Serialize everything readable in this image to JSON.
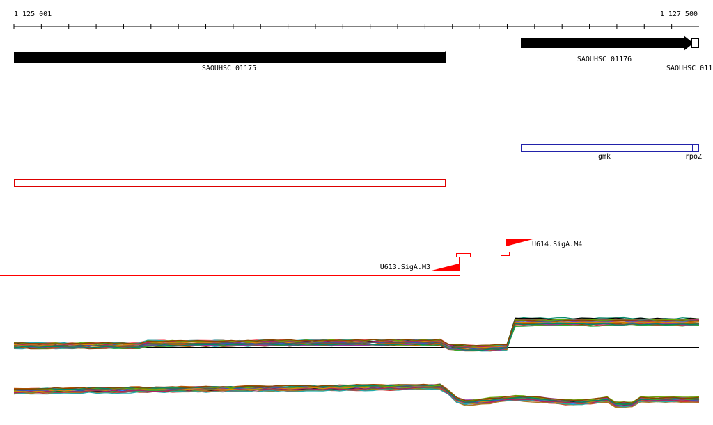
{
  "ruler": {
    "start_label": "1 125 001",
    "end_label": "1 127 500"
  },
  "genes_top": [
    {
      "label": "SAOUHSC_01175",
      "strand": "forward"
    },
    {
      "label": "SAOUHSC_01176",
      "strand": "forward"
    },
    {
      "label": "SAOUHSC_011",
      "strand": "forward"
    }
  ],
  "genes_names": [
    {
      "label": "gmk"
    },
    {
      "label": "rpoZ"
    }
  ],
  "promoters": [
    {
      "label": "U613.SigA.M3",
      "strand": "reverse"
    },
    {
      "label": "U614.SigA.M4",
      "strand": "forward"
    }
  ],
  "colors": {
    "gene": "#000000",
    "gene_name_box": "#2222aa",
    "annotation_box": "#dd0000",
    "promoter": "#ff0000"
  },
  "expression_panels": [
    {
      "name": "forward strand expression"
    },
    {
      "name": "reverse strand expression"
    }
  ]
}
